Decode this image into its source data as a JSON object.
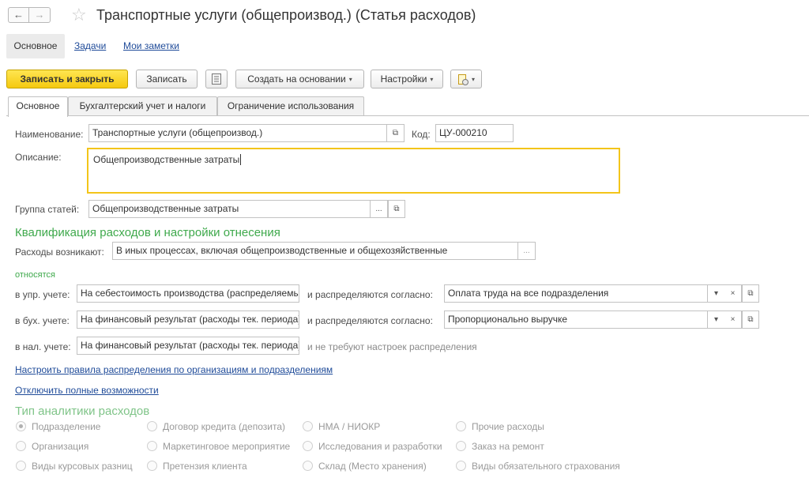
{
  "window": {
    "title": "Транспортные услуги (общепроизвод.) (Статья расходов)",
    "back_glyph": "←",
    "forward_glyph": "→",
    "star_glyph": "☆"
  },
  "section_tabs": {
    "main": "Основное",
    "tasks": "Задачи",
    "notes": "Мои заметки"
  },
  "toolbar": {
    "save_close": "Записать и закрыть",
    "save": "Записать",
    "create_based": "Создать на основании",
    "settings": "Настройки",
    "dropdown_glyph": "▾"
  },
  "form_tabs": [
    "Основное",
    "Бухгалтерский учет и налоги",
    "Ограничение использования"
  ],
  "form": {
    "name_label": "Наименование:",
    "name_value": "Транспортные услуги (общепроизвод.)",
    "code_label": "Код:",
    "code_value": "ЦУ-000210",
    "description_label": "Описание:",
    "description_value": "Общепроизводственные затраты",
    "group_label": "Группа статей:",
    "group_value": "Общепроизводственные затраты",
    "ellipsis": "...",
    "open_glyph": "⧉"
  },
  "qualification": {
    "header": "Квалификация расходов и настройки отнесения",
    "arise_label": "Расходы возникают:",
    "arise_value": "В иных процессах, включая общепроизводственные и общехозяйственные",
    "relates_label": "относятся",
    "mgmt_label": "в упр. учете:",
    "mgmt_value": "На себестоимость производства (распределяемые)",
    "mgmt_dist_label": "и распределяются согласно:",
    "mgmt_dist_value": "Оплата труда на все подразделения",
    "acc_label": "в бух. учете:",
    "acc_value": "На финансовый результат (расходы тек. периода)",
    "acc_dist_label": "и распределяются согласно:",
    "acc_dist_value": "Пропорционально выручке",
    "tax_label": "в нал. учете:",
    "tax_value": "На финансовый результат (расходы тек. периода)",
    "tax_note": "и не требуют настроек распределения",
    "clear_glyph": "×",
    "select_glyph": "▾"
  },
  "links": {
    "configure_rules": "Настроить правила распределения по организациям и подразделениям",
    "disable_full": "Отключить полные возможности"
  },
  "analytics": {
    "header": "Тип аналитики расходов",
    "columns": [
      [
        "Подразделение",
        "Организация",
        "Виды курсовых разниц"
      ],
      [
        "Договор кредита (депозита)",
        "Маркетинговое мероприятие",
        "Претензия клиента"
      ],
      [
        "НМА / НИОКР",
        "Исследования и разработки",
        "Склад (Место хранения)"
      ],
      [
        "Прочие расходы",
        "Заказ на ремонт",
        "Виды обязательного страхования"
      ]
    ],
    "selected": "Подразделение"
  }
}
